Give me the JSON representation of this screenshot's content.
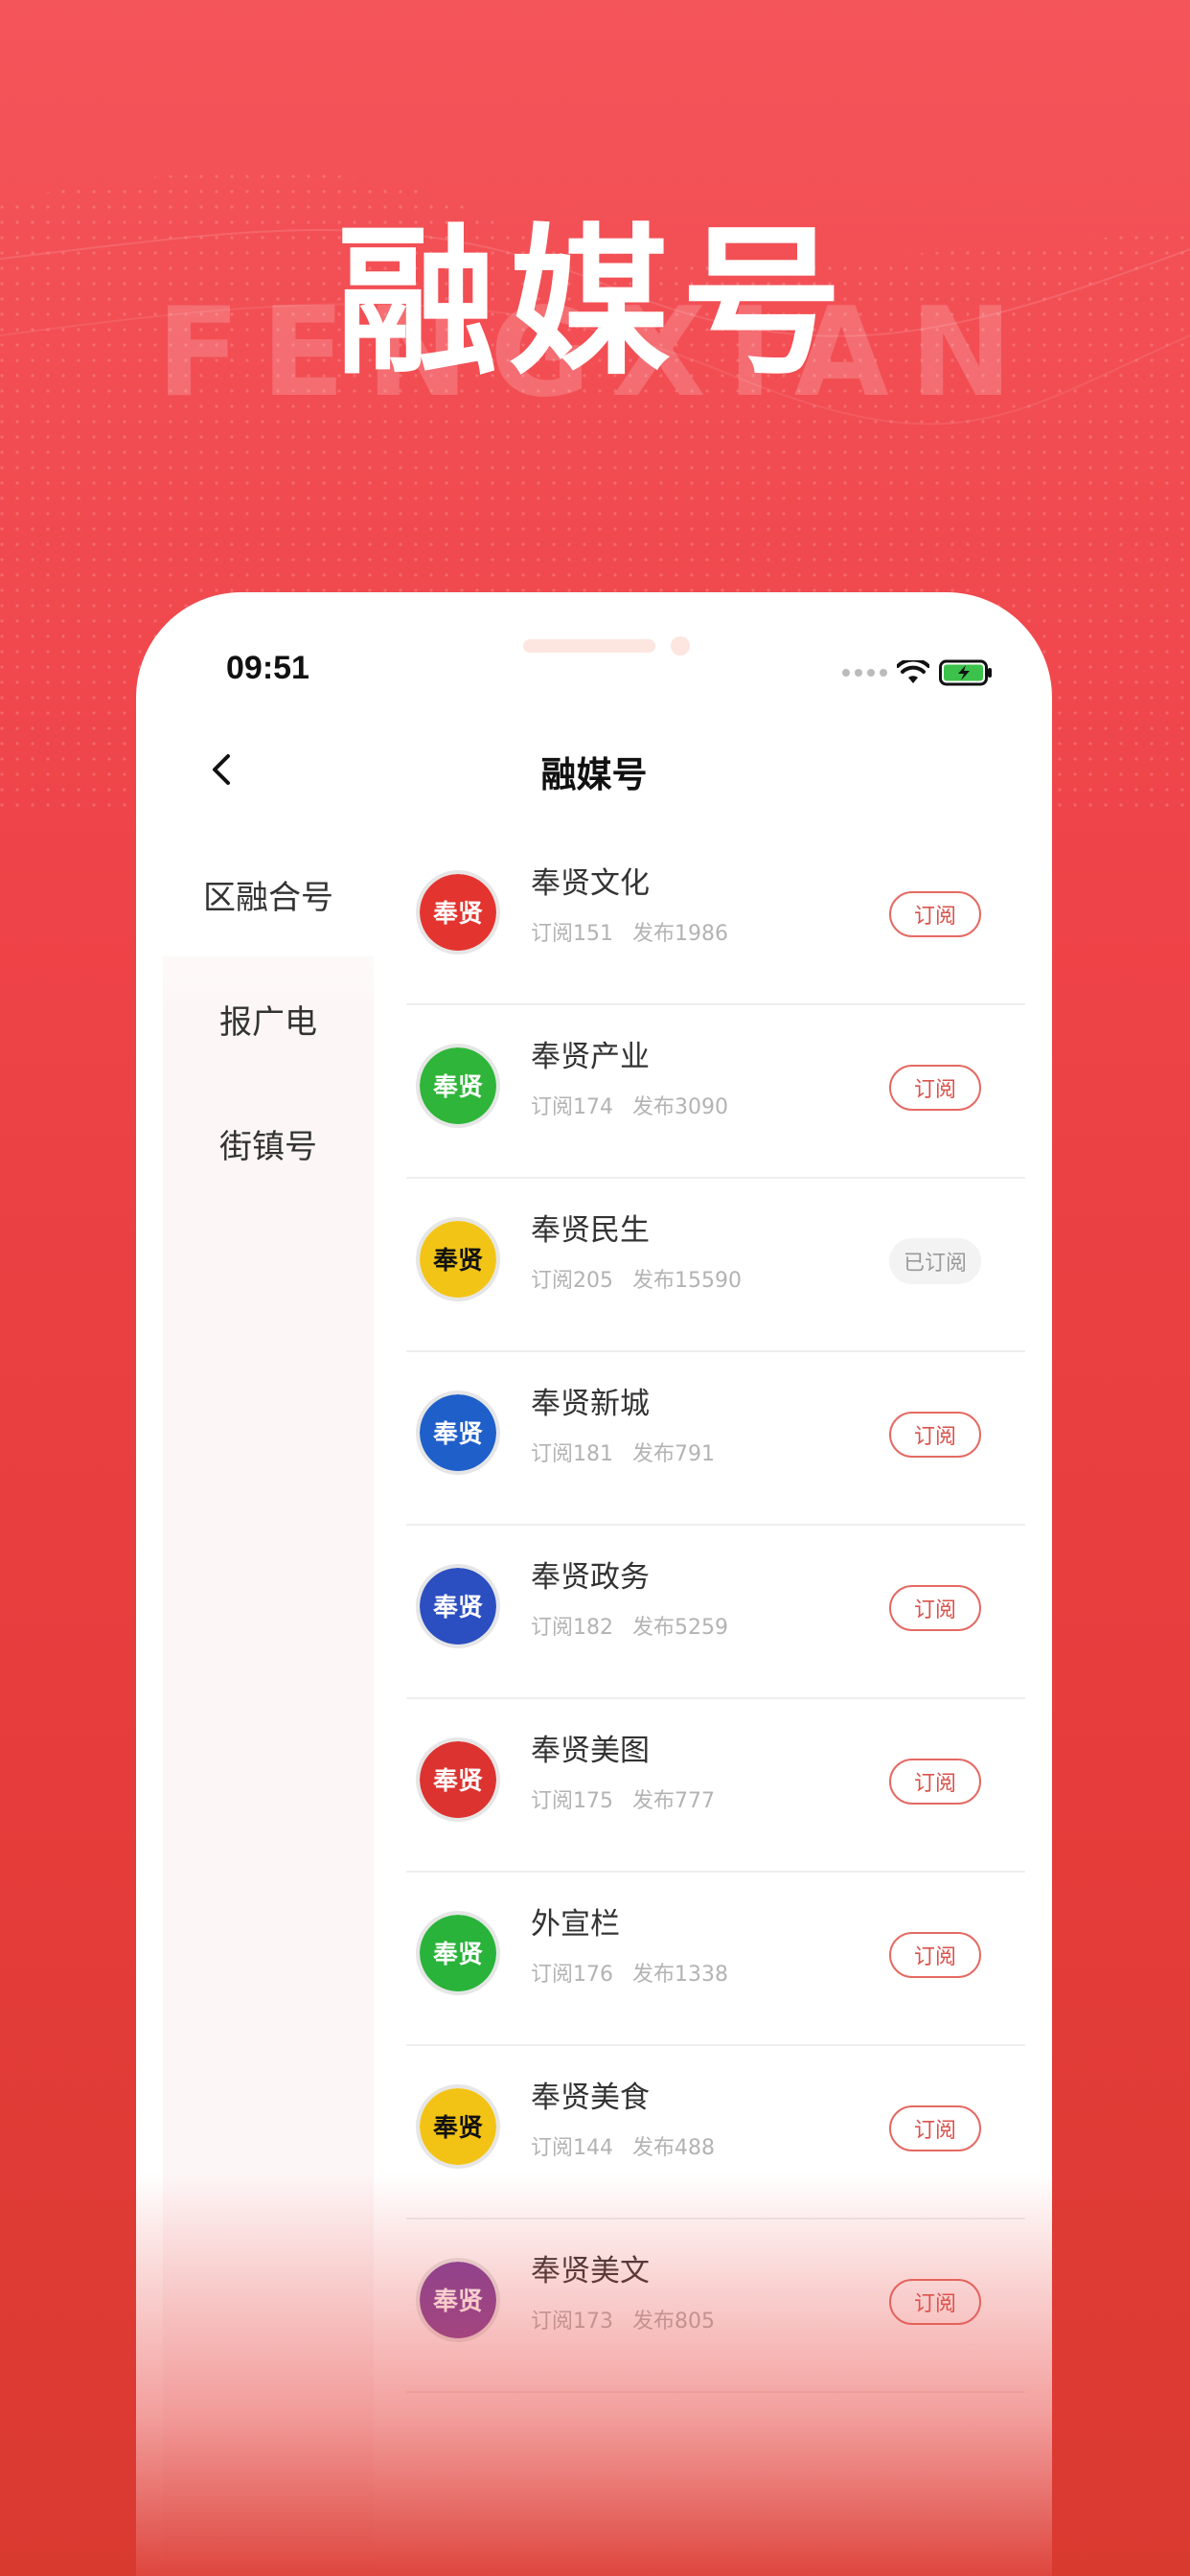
{
  "promo": {
    "title": "融媒号",
    "watermark": "FENGXIAN"
  },
  "status_bar": {
    "time": "09:51"
  },
  "nav": {
    "title": "融媒号"
  },
  "sidebar": {
    "items": [
      {
        "label": "区融合号",
        "active": true
      },
      {
        "label": "报广电",
        "active": false
      },
      {
        "label": "街镇号",
        "active": false
      }
    ]
  },
  "channels": [
    {
      "name": "奉贤文化",
      "subs": "订阅151",
      "posts": "发布1986",
      "button": "订阅",
      "subscribed": false,
      "color": "#e3342f",
      "avatar_text": "奉贤"
    },
    {
      "name": "奉贤产业",
      "subs": "订阅174",
      "posts": "发布3090",
      "button": "订阅",
      "subscribed": false,
      "color": "#2fb53a",
      "avatar_text": "奉贤"
    },
    {
      "name": "奉贤民生",
      "subs": "订阅205",
      "posts": "发布15590",
      "button": "已订阅",
      "subscribed": true,
      "color": "#f2c416",
      "avatar_text": "奉贤"
    },
    {
      "name": "奉贤新城",
      "subs": "订阅181",
      "posts": "发布791",
      "button": "订阅",
      "subscribed": false,
      "color": "#1f5fc9",
      "avatar_text": "奉贤"
    },
    {
      "name": "奉贤政务",
      "subs": "订阅182",
      "posts": "发布5259",
      "button": "订阅",
      "subscribed": false,
      "color": "#2b4fc0",
      "avatar_text": "奉贤"
    },
    {
      "name": "奉贤美图",
      "subs": "订阅175",
      "posts": "发布777",
      "button": "订阅",
      "subscribed": false,
      "color": "#dc3330",
      "avatar_text": "奉贤"
    },
    {
      "name": "外宣栏",
      "subs": "订阅176",
      "posts": "发布1338",
      "button": "订阅",
      "subscribed": false,
      "color": "#29b33a",
      "avatar_text": "奉贤"
    },
    {
      "name": "奉贤美食",
      "subs": "订阅144",
      "posts": "发布488",
      "button": "订阅",
      "subscribed": false,
      "color": "#f2c314",
      "avatar_text": "奉贤"
    },
    {
      "name": "奉贤美文",
      "subs": "订阅173",
      "posts": "发布805",
      "button": "订阅",
      "subscribed": false,
      "color": "#7b3f9c",
      "avatar_text": "奉贤"
    }
  ]
}
